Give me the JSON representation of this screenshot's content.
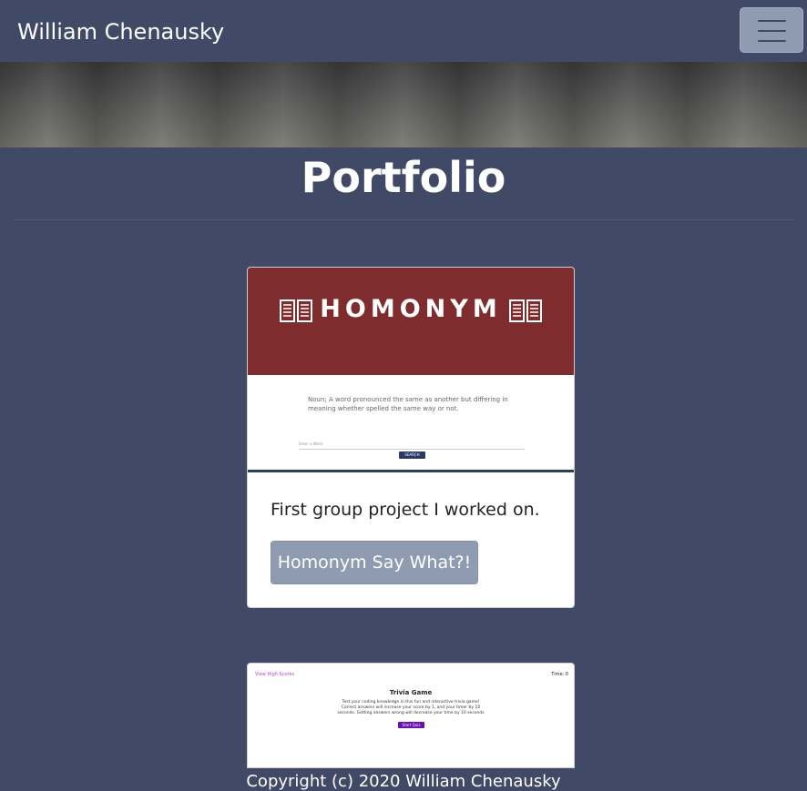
{
  "navbar": {
    "brand": "William Chenausky",
    "toggler_icon": "hamburger-menu-icon"
  },
  "page": {
    "title": "Portfolio"
  },
  "projects": [
    {
      "screenshot": {
        "logo_text": "HOMONYM",
        "definition": "Noun; A word pronounced the same as another but differing in meaning whether spelled the same way or not.",
        "input_placeholder": "Enter a Word",
        "button_label": "SEARCH"
      },
      "description": "First group project I worked on.",
      "button_label": "Homonym Say What?!"
    },
    {
      "screenshot": {
        "link": "View High Scores",
        "time": "Time: 0",
        "title": "Trivia Game",
        "description": "Test your coding knowledge in this fun and interactive trivia game! Correct answers will increase your score by 1, and your timer by 10 seconds. Getting answers wrong will decrease your time by 10 seconds",
        "button_label": "Start Quiz"
      }
    }
  ],
  "footer": {
    "copyright": "Copyright (c) 2020 William Chenausky"
  },
  "colors": {
    "background": "#404965",
    "button": "#8f9bb1",
    "homonym_header": "#7f2c2f"
  }
}
